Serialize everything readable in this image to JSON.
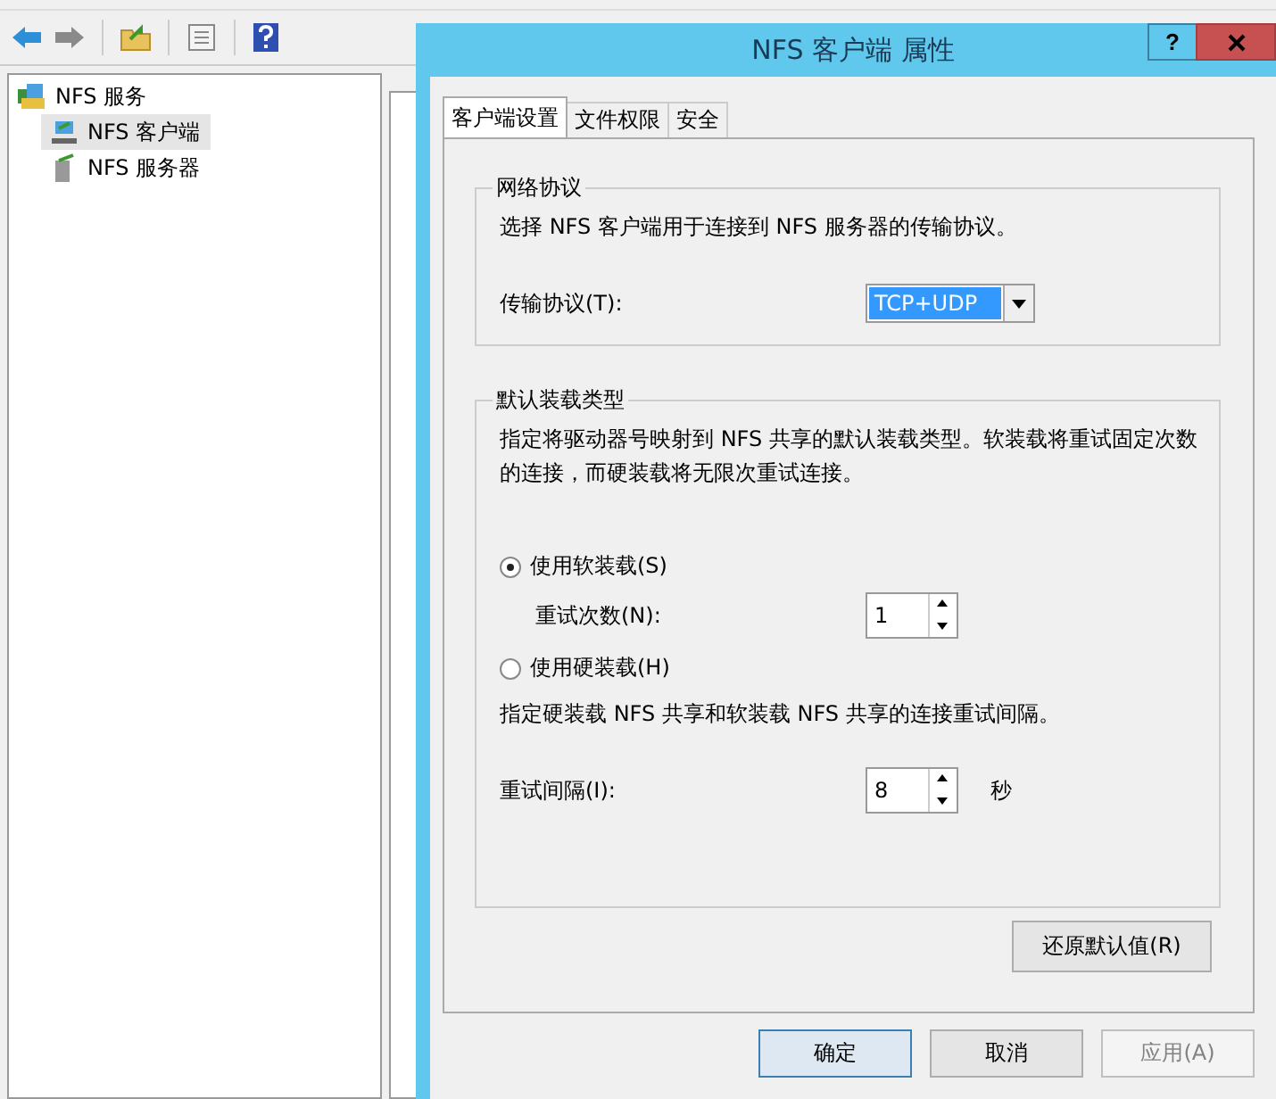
{
  "tree": [
    {
      "label": "NFS 服务",
      "selected": false,
      "children": [
        {
          "label": "NFS 客户端",
          "selected": true
        },
        {
          "label": "NFS 服务器",
          "selected": false
        }
      ]
    }
  ],
  "dialog": {
    "title": "NFS 客户端 属性",
    "help": "?",
    "tabs": [
      {
        "label": "客户端设置",
        "selected": true
      },
      {
        "label": "文件权限",
        "selected": false
      },
      {
        "label": "安全",
        "selected": false
      }
    ],
    "network_protocol": {
      "title": "网络协议",
      "description": "选择 NFS 客户端用于连接到 NFS 服务器的传输协议。",
      "transport_label": "传输协议(T):",
      "transport_value": "TCP+UDP"
    },
    "mount_type": {
      "title": "默认装载类型",
      "description": "指定将驱动器号映射到 NFS 共享的默认装载类型。软装载将重试固定次数的连接，而硬装载将无限次重试连接。",
      "options": [
        {
          "label": "使用软装载(S)",
          "selected": true
        },
        {
          "label": "使用硬装载(H)",
          "selected": false
        }
      ],
      "retry_count_label": "重试次数(N):",
      "retry_count": "1",
      "interval_note": "指定硬装载 NFS 共享和软装载 NFS 共享的连接重试间隔。",
      "retry_interval_label": "重试间隔(I):",
      "retry_interval": "8",
      "retry_interval_unit": "秒"
    },
    "restore_button": "还原默认值(R)",
    "buttons": [
      {
        "label": "确定",
        "default": true,
        "disabled": false
      },
      {
        "label": "取消",
        "default": false,
        "disabled": false
      },
      {
        "label": "应用(A)",
        "default": false,
        "disabled": true
      }
    ]
  }
}
